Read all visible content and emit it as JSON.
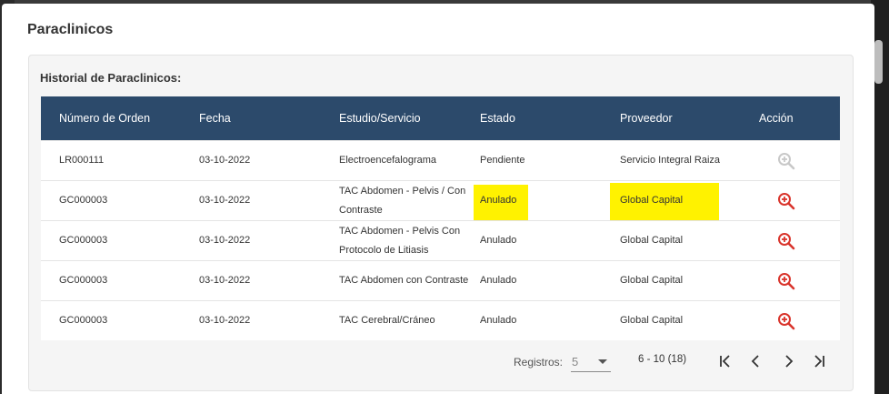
{
  "modal": {
    "title": "Paraclinicos"
  },
  "card": {
    "title": "Historial de Paraclinicos:"
  },
  "table": {
    "headers": [
      "Número de Orden",
      "Fecha",
      "Estudio/Servicio",
      "Estado",
      "Proveedor",
      "Acción"
    ],
    "rows": [
      {
        "orden": "LR000111",
        "fecha": "03-10-2022",
        "estudio": "Electroencefalograma",
        "estado": "Pendiente",
        "proveedor": "Servicio Integral Raiza",
        "action_icon": "zoom-in-icon"
      },
      {
        "orden": "GC000003",
        "fecha": "03-10-2022",
        "estudio": "TAC Abdomen - Pelvis / Con Contraste",
        "estado": "Anulado",
        "proveedor": "Global Capital",
        "action_icon": "zoom-in-icon"
      },
      {
        "orden": "GC000003",
        "fecha": "03-10-2022",
        "estudio": "TAC Abdomen - Pelvis Con Protocolo de Litiasis",
        "estado": "Anulado",
        "proveedor": "Global Capital",
        "action_icon": "zoom-in-icon"
      },
      {
        "orden": "GC000003",
        "fecha": "03-10-2022",
        "estudio": "TAC Abdomen con Contraste",
        "estado": "Anulado",
        "proveedor": "Global Capital",
        "action_icon": "zoom-in-icon"
      },
      {
        "orden": "GC000003",
        "fecha": "03-10-2022",
        "estudio": "TAC Cerebral/Cráneo",
        "estado": "Anulado",
        "proveedor": "Global Capital",
        "action_icon": "zoom-in-icon"
      }
    ]
  },
  "pagination": {
    "label": "Registros:",
    "page_size": "5",
    "range": "6 - 10 (18)",
    "icons": [
      "first-page-icon",
      "prev-page-icon",
      "next-page-icon",
      "last-page-icon"
    ]
  },
  "colors": {
    "header_bg": "#2c4a6b",
    "highlight": "#fff200",
    "action_active": "#d9342b",
    "action_disabled": "#c8c8c8"
  }
}
